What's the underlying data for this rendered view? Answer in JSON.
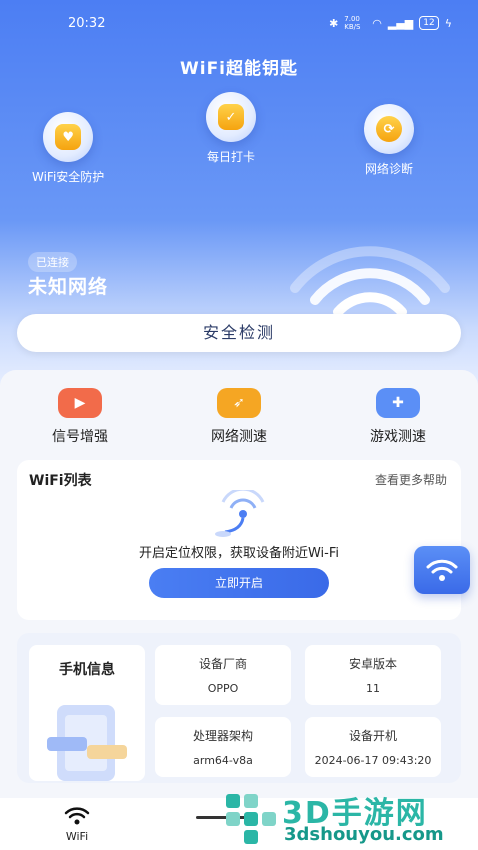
{
  "status_bar": {
    "time": "20:32",
    "signal_text": "7.00 KB/S",
    "battery": "12"
  },
  "app": {
    "title": "WiFi超能钥匙"
  },
  "features": [
    {
      "label": "WiFi安全防护",
      "icon": "shield-icon"
    },
    {
      "label": "每日打卡",
      "icon": "calendar-icon"
    },
    {
      "label": "网络诊断",
      "icon": "refresh-icon"
    }
  ],
  "connection": {
    "badge": "已连接",
    "network": "未知网络"
  },
  "check_button": "安全检测",
  "tools": [
    {
      "label": "信号增强",
      "icon": "signal-boost-icon",
      "color": "#f26b4a"
    },
    {
      "label": "网络测速",
      "icon": "rocket-icon",
      "color": "#f5a623"
    },
    {
      "label": "游戏测速",
      "icon": "gamepad-icon",
      "color": "#5b8ff6"
    }
  ],
  "wifi_list": {
    "title": "WiFi列表",
    "more": "查看更多帮助",
    "message": "开启定位权限，获取设备附近Wi-Fi",
    "button": "立即开启"
  },
  "device_info": {
    "title": "手机信息",
    "cells": [
      {
        "key": "设备厂商",
        "value": "OPPO"
      },
      {
        "key": "安卓版本",
        "value": "11"
      },
      {
        "key": "处理器架构",
        "value": "arm64-v8a"
      },
      {
        "key": "设备开机",
        "value": "2024-06-17 09:43:20"
      }
    ]
  },
  "bottom_nav": {
    "label": "WiFi"
  },
  "watermark": {
    "title": "3D手游网",
    "url": "3dshouyou.com"
  },
  "colors": {
    "primary": "#4c7ef3",
    "accent": "#2bb6a6"
  }
}
